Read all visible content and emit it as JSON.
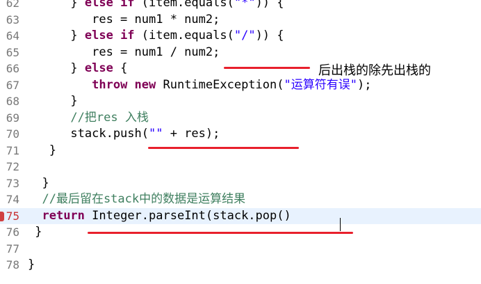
{
  "editor": {
    "lines": [
      {
        "num": "62",
        "code": [
          {
            "t": "      } ",
            "c": ""
          },
          {
            "t": "else if",
            "c": "kw"
          },
          {
            "t": " (item.equals(",
            "c": ""
          },
          {
            "t": "\"*\"",
            "c": "str"
          },
          {
            "t": ")) {",
            "c": ""
          }
        ]
      },
      {
        "num": "63",
        "code": [
          {
            "t": "         res = num1 * num2;",
            "c": ""
          }
        ]
      },
      {
        "num": "64",
        "code": [
          {
            "t": "      } ",
            "c": ""
          },
          {
            "t": "else if",
            "c": "kw"
          },
          {
            "t": " (item.equals(",
            "c": ""
          },
          {
            "t": "\"/\"",
            "c": "str"
          },
          {
            "t": ")) {",
            "c": ""
          }
        ]
      },
      {
        "num": "65",
        "code": [
          {
            "t": "         res = num1 / num2;",
            "c": ""
          }
        ]
      },
      {
        "num": "66",
        "code": [
          {
            "t": "      } ",
            "c": ""
          },
          {
            "t": "else",
            "c": "kw"
          },
          {
            "t": " {",
            "c": ""
          }
        ]
      },
      {
        "num": "67",
        "code": [
          {
            "t": "         ",
            "c": ""
          },
          {
            "t": "throw new",
            "c": "kw"
          },
          {
            "t": " RuntimeException(",
            "c": ""
          },
          {
            "t": "\"运算符有误\"",
            "c": "str"
          },
          {
            "t": ");",
            "c": ""
          }
        ]
      },
      {
        "num": "68",
        "code": [
          {
            "t": "      }",
            "c": ""
          }
        ]
      },
      {
        "num": "69",
        "code": [
          {
            "t": "      //把res 入栈",
            "c": "cm"
          }
        ]
      },
      {
        "num": "70",
        "code": [
          {
            "t": "      stack.push(",
            "c": ""
          },
          {
            "t": "\"\"",
            "c": "str"
          },
          {
            "t": " + res);",
            "c": ""
          }
        ]
      },
      {
        "num": "71",
        "code": [
          {
            "t": "   }",
            "c": ""
          }
        ]
      },
      {
        "num": "72",
        "code": [
          {
            "t": "",
            "c": ""
          }
        ]
      },
      {
        "num": "73",
        "code": [
          {
            "t": "  }",
            "c": ""
          }
        ]
      },
      {
        "num": "74",
        "code": [
          {
            "t": "  //最后留在stack中的数据是运算结果",
            "c": "cm"
          }
        ]
      },
      {
        "num": "75",
        "code": [
          {
            "t": "  ",
            "c": ""
          },
          {
            "t": "return",
            "c": "kw"
          },
          {
            "t": " Integer.parseInt(stack.pop()",
            "c": ""
          }
        ],
        "current": true
      },
      {
        "num": "76",
        "code": [
          {
            "t": " }",
            "c": ""
          }
        ]
      },
      {
        "num": "77",
        "code": [
          {
            "t": "",
            "c": ""
          }
        ]
      },
      {
        "num": "78",
        "code": [
          {
            "t": "}",
            "c": ""
          }
        ]
      }
    ]
  },
  "annotation": {
    "text": "后出栈的除先出栈的"
  },
  "colors": {
    "keyword": "#7f0055",
    "string": "#2a00ff",
    "comment": "#3f7f5f",
    "underline": "#e8202c",
    "current_line": "#e8f2fe",
    "breakpoint": "#c83232"
  }
}
